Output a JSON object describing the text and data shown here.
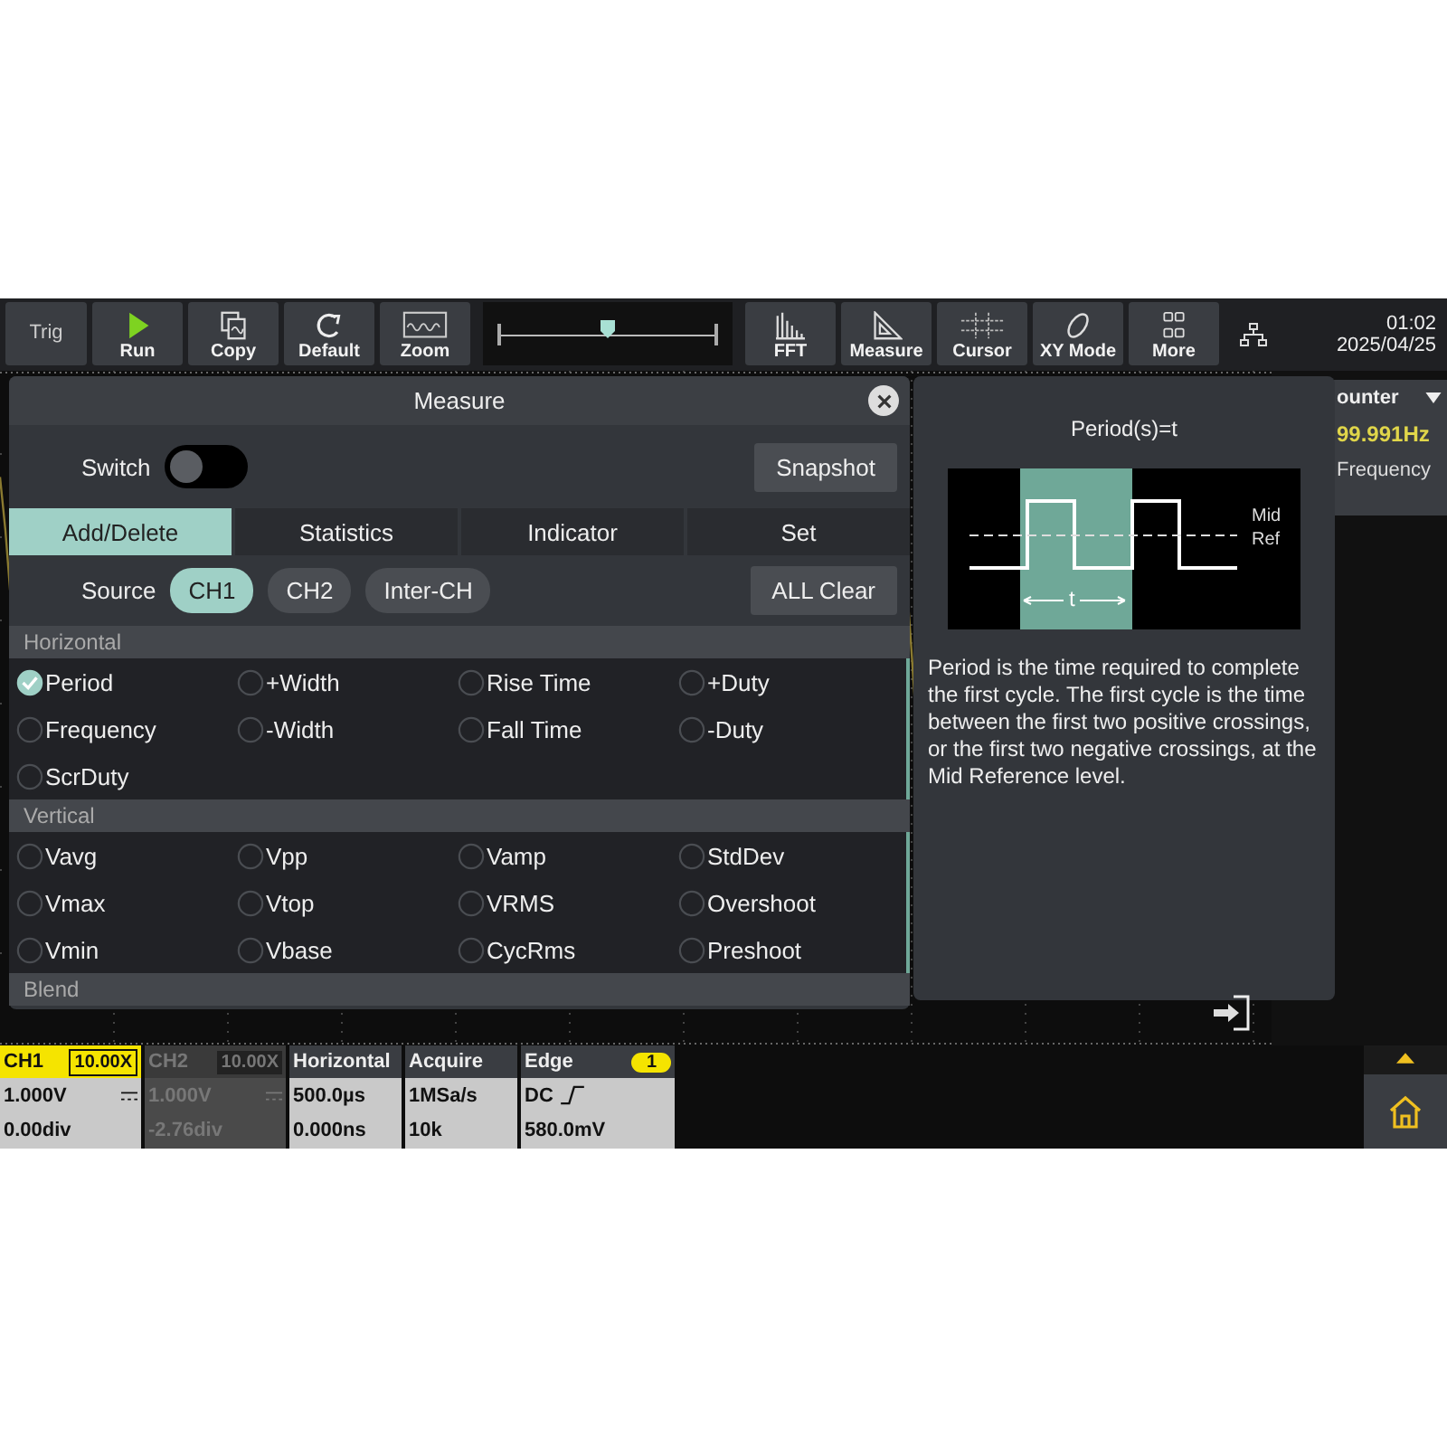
{
  "toolbar": {
    "left": [
      {
        "label": "Trig",
        "kind": "text"
      },
      {
        "label": "Run",
        "kind": "run"
      },
      {
        "label": "Copy",
        "kind": "copy"
      },
      {
        "label": "Default",
        "kind": "default"
      },
      {
        "label": "Zoom",
        "kind": "zoom"
      }
    ],
    "timebase_slider": {
      "level": 0.5
    },
    "right": [
      {
        "label": "FFT",
        "kind": "fft"
      },
      {
        "label": "Measure",
        "kind": "measure"
      },
      {
        "label": "Cursor",
        "kind": "cursor"
      },
      {
        "label": "XY Mode",
        "kind": "xy"
      },
      {
        "label": "More",
        "kind": "more"
      }
    ],
    "clock": {
      "time": "01:02",
      "date": "2025/04/25"
    }
  },
  "measure_dialog": {
    "title": "Measure",
    "switch": {
      "label": "Switch",
      "on": false
    },
    "snapshot_button": "Snapshot",
    "tabs": [
      {
        "label": "Add/Delete",
        "selected": true
      },
      {
        "label": "Statistics",
        "selected": false
      },
      {
        "label": "Indicator",
        "selected": false
      },
      {
        "label": "Set",
        "selected": false
      }
    ],
    "source": {
      "label": "Source",
      "options": [
        {
          "label": "CH1",
          "selected": true
        },
        {
          "label": "CH2",
          "selected": false
        },
        {
          "label": "Inter-CH",
          "selected": false
        }
      ]
    },
    "all_clear_button": "ALL Clear",
    "sections": [
      {
        "title": "Horizontal",
        "items": [
          {
            "label": "Period",
            "checked": true
          },
          {
            "label": "+Width",
            "checked": false
          },
          {
            "label": "Rise Time",
            "checked": false
          },
          {
            "label": "+Duty",
            "checked": false
          },
          {
            "label": "Frequency",
            "checked": false
          },
          {
            "label": "-Width",
            "checked": false
          },
          {
            "label": "Fall Time",
            "checked": false
          },
          {
            "label": "-Duty",
            "checked": false
          },
          {
            "label": "ScrDuty",
            "checked": false
          }
        ]
      },
      {
        "title": "Vertical",
        "items": [
          {
            "label": "Vavg",
            "checked": false
          },
          {
            "label": "Vpp",
            "checked": false
          },
          {
            "label": "Vamp",
            "checked": false
          },
          {
            "label": "StdDev",
            "checked": false
          },
          {
            "label": "Vmax",
            "checked": false
          },
          {
            "label": "Vtop",
            "checked": false
          },
          {
            "label": "VRMS",
            "checked": false
          },
          {
            "label": "Overshoot",
            "checked": false
          },
          {
            "label": "Vmin",
            "checked": false
          },
          {
            "label": "Vbase",
            "checked": false
          },
          {
            "label": "CycRms",
            "checked": false
          },
          {
            "label": "Preshoot",
            "checked": false
          }
        ]
      },
      {
        "title": "Blend"
      }
    ]
  },
  "info_panel": {
    "title": "Period(s)=t",
    "diagram": {
      "mid_label": "Mid",
      "ref_label": "Ref",
      "period_label": "t"
    },
    "description": "Period is the time required to complete the first cycle. The first cycle is the time between the first two positive crossings, or the first two negative crossings, at the Mid Reference level."
  },
  "counter": {
    "title": "ounter",
    "value": "99.991Hz",
    "label": "Frequency"
  },
  "status_cards": [
    {
      "kind": "channel",
      "title": "CH1",
      "probe": "10.00X",
      "selected": true,
      "line_1": "1.000V",
      "line_2": "0.00div"
    },
    {
      "kind": "channel",
      "title": "CH2",
      "probe": "10.00X",
      "selected": false,
      "line_1": "1.000V",
      "line_2": "-2.76div"
    },
    {
      "kind": "plain",
      "title": "Horizontal",
      "line_1": "500.0µs",
      "line_2": "0.000ns"
    },
    {
      "kind": "plain",
      "title": "Acquire",
      "line_1": "1MSa/s",
      "line_2": "10k"
    },
    {
      "kind": "trigger",
      "title": "Edge",
      "badge": "1",
      "line_1": "DC",
      "line_2": "580.0mV"
    }
  ]
}
